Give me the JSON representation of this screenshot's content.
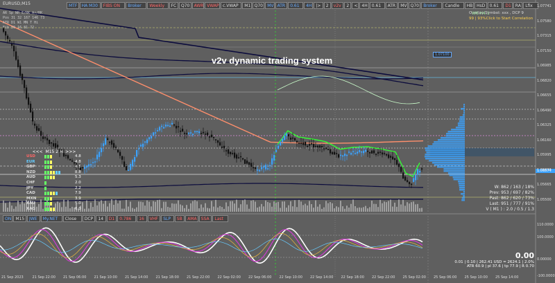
{
  "window": {
    "symbol": "EURUSD,M15",
    "title": "v2v dynamic trading system"
  },
  "top_toolbar": [
    {
      "label": "MTF",
      "color": "#6af"
    },
    {
      "label": "HA M30",
      "color": "#6af"
    },
    {
      "label": "FIBS ON",
      "color": "#f66"
    },
    {
      "label": "Broker",
      "color": "#6af"
    },
    {
      "label": "Weekly",
      "color": "#f66"
    },
    {
      "label": "FC",
      "color": "#ddd"
    },
    {
      "label": "Q70",
      "color": "#ddd"
    },
    {
      "label": "AWR",
      "color": "#f66"
    },
    {
      "label": "VWAP",
      "color": "#f66"
    },
    {
      "label": "c.VWAP",
      "color": "#ddd"
    },
    {
      "label": "M1",
      "color": "#ddd"
    },
    {
      "label": "Q70",
      "color": "#ddd"
    },
    {
      "label": "MV",
      "color": "#6af"
    },
    {
      "label": "ATR",
      "color": "#6af"
    },
    {
      "label": "0.61",
      "color": "#6af"
    },
    {
      "label": "4H",
      "color": "#6af"
    },
    {
      "label": "|>",
      "color": "#ddd"
    },
    {
      "label": "2",
      "color": "#ddd"
    },
    {
      "label": "v2v",
      "color": "#f66"
    },
    {
      "label": "2",
      "color": "#ddd"
    },
    {
      "label": "<",
      "color": "#ddd"
    },
    {
      "label": "4H",
      "color": "#ddd"
    },
    {
      "label": "0.61",
      "color": "#ddd"
    },
    {
      "label": "ATR",
      "color": "#ddd"
    },
    {
      "label": "MV",
      "color": "#ddd"
    },
    {
      "label": "Q70",
      "color": "#ddd"
    },
    {
      "label": "Broker",
      "color": "#6af"
    },
    {
      "label": "Candle",
      "color": "#ddd"
    },
    {
      "label": "HB",
      "color": "#ddd"
    },
    {
      "label": "HsD",
      "color": "#ddd"
    },
    {
      "label": "0.61",
      "color": "#ddd"
    },
    {
      "label": "D1",
      "color": "#f66"
    },
    {
      "label": "RA",
      "color": "#ddd"
    },
    {
      "label": "Lfix",
      "color": "#ddd"
    }
  ],
  "bottom_toolbar": [
    {
      "label": "ON",
      "color": "#6af"
    },
    {
      "label": "M15",
      "color": "#ddd"
    },
    {
      "label": "JWE",
      "color": "#6af"
    },
    {
      "label": "My.NET",
      "color": "#6af"
    },
    {
      "label": "Close",
      "color": "#ddd"
    },
    {
      "label": "DCP",
      "color": "#ddd"
    },
    {
      "label": "14",
      "color": "#ddd"
    },
    {
      "label": "D1",
      "color": "#f66"
    },
    {
      "label": "0.786",
      "color": "#f66"
    },
    {
      "label": "16",
      "color": "#f66"
    },
    {
      "label": "VHF",
      "color": "#f66"
    },
    {
      "label": "SLP",
      "color": "#6af"
    },
    {
      "label": "SB",
      "color": "#f66"
    },
    {
      "label": "AMA",
      "color": "#f66"
    },
    {
      "label": "SSA",
      "color": "#f66"
    },
    {
      "label": "Last",
      "color": "#f66"
    }
  ],
  "stats_panel": {
    "rows": [
      "AR   Sp   NR   E/RK   Ar/RK",
      "Pos   31   32   167   146    73",
      "ATR   D1   W1   MN   T    Hi",
      "Fib        50  16   81   72"
    ]
  },
  "currency_strength": {
    "header": "M15  2  H",
    "items": [
      {
        "name": "USD",
        "value": "4.8",
        "color": "#f66"
      },
      {
        "name": "EUR",
        "value": "4.8",
        "color": "#6cf"
      },
      {
        "name": "GBP",
        "value": "4.8",
        "color": "#ddd"
      },
      {
        "name": "NZD",
        "value": "8.8",
        "color": "#ddd"
      },
      {
        "name": "AUD",
        "value": "5.3",
        "color": "#ddd"
      },
      {
        "name": "CHF",
        "value": "2.0",
        "color": "#ddd"
      },
      {
        "name": "JPY",
        "value": "2.2",
        "color": "#ddd"
      },
      {
        "name": "CAD",
        "value": "7.9",
        "color": "#ddd"
      },
      {
        "name": "MXN",
        "value": "3.9",
        "color": "#ddd"
      },
      {
        "name": "XAU",
        "value": "5.0",
        "color": "#ddd"
      },
      {
        "name": "XAG",
        "value": "6.0",
        "color": "#ddd"
      }
    ]
  },
  "overlay_panel": {
    "line1": "Overlay Symbol: xxx , DCP 9",
    "line2": "99 | 93%Click to Start Correlation",
    "stats": [
      "W: 862 / 163 / 18%",
      "Prev: 953 / 697 / 82%",
      "Past: 862 / 620 / 73%",
      "Last: 951 / 777 / 91%",
      "V ( M1 ) : 2.0 / 0.5 / 1.3"
    ]
  },
  "levels": {
    "wh1": "W6.H4.1",
    "pivot_box": "1.07100",
    "current_price": "1.06574"
  },
  "lower_panel": {
    "value": "0.00",
    "line1": "0.01  |  0.10  |  262.41 USD = 2624.1  |  2.0%",
    "line2": "ATR 60.9  |  pl 37.6  |  tp 77.9  |  R 0.70"
  },
  "price_axis": [
    "1.07741",
    "1.07580",
    "1.07315",
    "1.07150",
    "1.06985",
    "1.06820",
    "1.06655",
    "1.06490",
    "1.06325",
    "1.06160",
    "1.05995",
    "1.05830",
    "1.05665",
    "1.05500"
  ],
  "time_axis": [
    "21 Sep 2023",
    "21 Sep 22:00",
    "21 Sep 06:00",
    "21 Sep 10:00",
    "21 Sep 14:00",
    "21 Sep 18:00",
    "21 Sep 22:00",
    "22 Sep 02:00",
    "22 Sep 06:00",
    "22 Sep 10:00",
    "22 Sep 14:00",
    "22 Sep 18:00",
    "22 Sep 22:00",
    "25 Sep 02:00",
    "25 Sep 06:00",
    "25 Sep 10:00",
    "25 Sep 14:00"
  ],
  "osc_axis": [
    "110.0000",
    "100.0000",
    "0.00000",
    "-100.0000"
  ],
  "colors": {
    "background": "#5f5f5f",
    "bull": "#3ba3ff",
    "bear": "#111111",
    "band": "#0b0b3c",
    "ma": "#ff8f6c"
  }
}
